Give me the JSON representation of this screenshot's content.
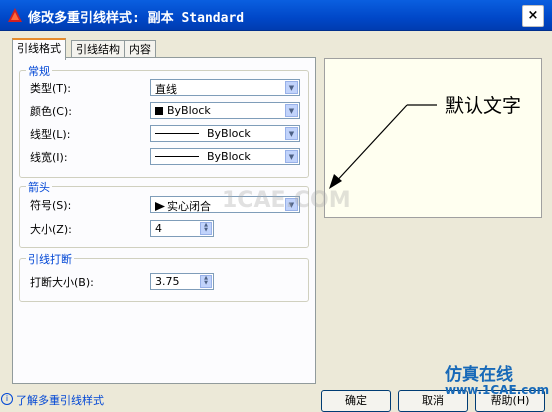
{
  "window": {
    "title": "修改多重引线样式: 副本 Standard",
    "close_label": "×"
  },
  "tabs": [
    {
      "label": "引线格式",
      "active": true
    },
    {
      "label": "引线结构",
      "active": false
    },
    {
      "label": "内容",
      "active": false
    }
  ],
  "general": {
    "legend": "常规",
    "type_label": "类型(T):",
    "type_value": "直线",
    "color_label": "颜色(C):",
    "color_value": "ByBlock",
    "linetype_label": "线型(L):",
    "linetype_value": "ByBlock",
    "lineweight_label": "线宽(I):",
    "lineweight_value": "ByBlock"
  },
  "arrowhead": {
    "legend": "箭头",
    "symbol_label": "符号(S):",
    "symbol_value": "实心闭合",
    "size_label": "大小(Z):",
    "size_value": "4"
  },
  "break": {
    "legend": "引线打断",
    "size_label": "打断大小(B):",
    "size_value": "3.75"
  },
  "preview": {
    "label_text": "默认文字"
  },
  "footer": {
    "help_link": "了解多重引线样式",
    "ok_label": "确定",
    "cancel_label": "取消",
    "help_label": "帮助(H)"
  },
  "watermark": {
    "center": "1CAE.COM",
    "site_name": "仿真在线",
    "site_url": "www.1CAE.com"
  },
  "colors": {
    "title_bar": "#0047c8",
    "accent_blue": "#0046d5",
    "dialog_bg": "#ece9d8"
  }
}
